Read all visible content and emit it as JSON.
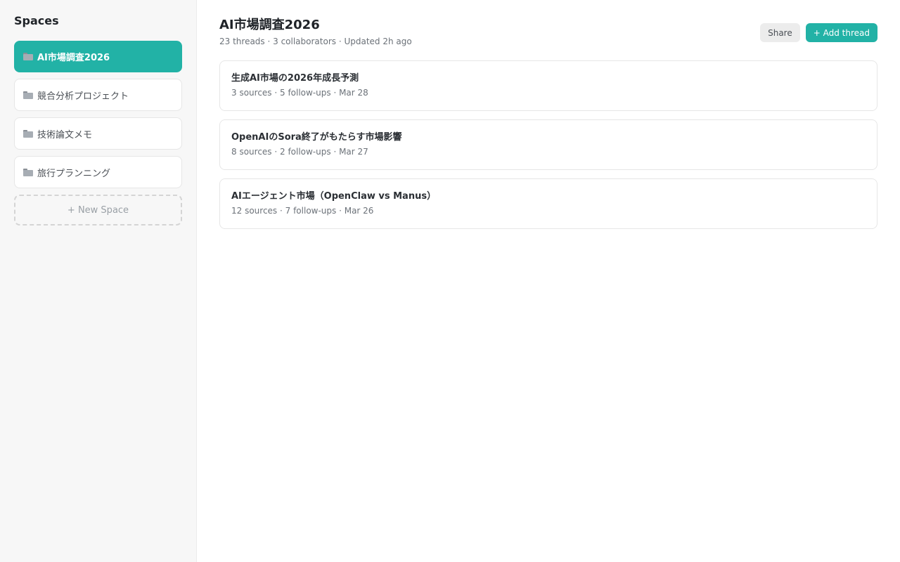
{
  "sidebar": {
    "title": "Spaces",
    "items": [
      {
        "icon": "folder-icon",
        "label": "AI市場調査2026",
        "active": true
      },
      {
        "icon": "folder-icon",
        "label": "競合分析プロジェクト",
        "active": false
      },
      {
        "icon": "folder-icon",
        "label": "技術論文メモ",
        "active": false
      },
      {
        "icon": "folder-icon",
        "label": "旅行プランニング",
        "active": false
      }
    ],
    "new_space_label": "+ New Space"
  },
  "main": {
    "title": "AI市場調査2026",
    "meta": "23 threads · 3 collaborators · Updated 2h ago",
    "share_label": "Share",
    "add_thread_label": "+ Add thread",
    "threads": [
      {
        "title": "生成AI市場の2026年成長予測",
        "meta": "3 sources · 5 follow-ups · Mar 28"
      },
      {
        "title": "OpenAIのSora終了がもたらす市場影響",
        "meta": "8 sources · 2 follow-ups · Mar 27"
      },
      {
        "title": "AIエージェント市場（OpenClaw vs Manus）",
        "meta": "12 sources · 7 follow-ups · Mar 26"
      }
    ]
  },
  "colors": {
    "accent": "#22b2a6",
    "sidebar_bg": "#f7f7f7"
  }
}
